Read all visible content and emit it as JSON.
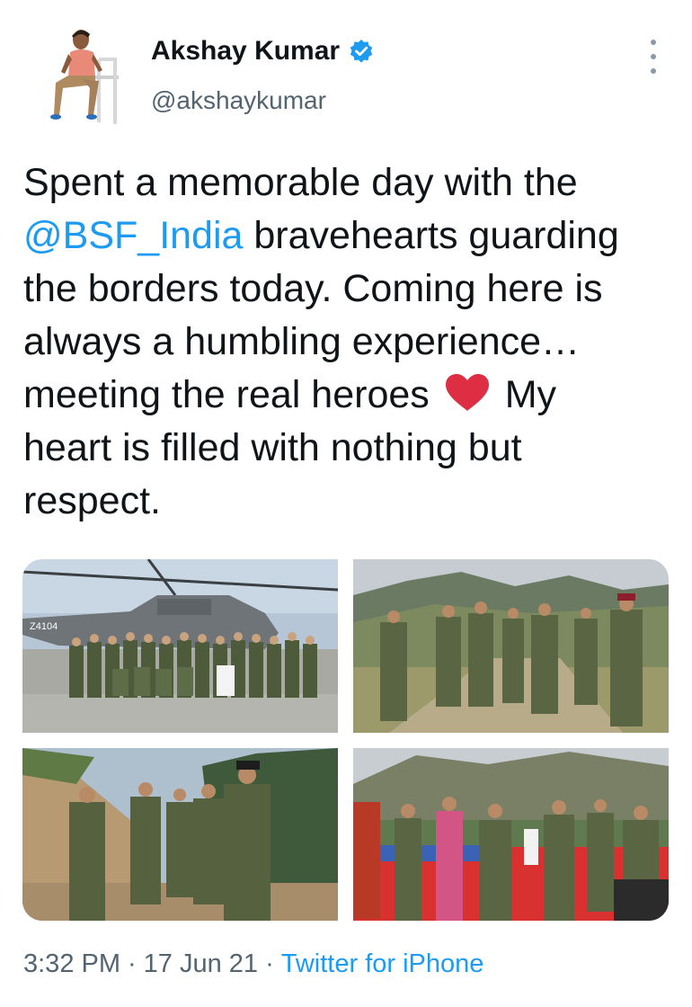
{
  "author": {
    "name": "Akshay Kumar",
    "handle": "@akshaykumar",
    "verified": true,
    "avatar_icon": "profile-photo"
  },
  "tweet": {
    "line1": "Spent a memorable day with the",
    "mention": "@BSF_India",
    "line2_rest": " bravehearts guarding",
    "line3": "the borders today. Coming here is",
    "line4": "always a humbling experience…",
    "line5_before_emoji": "meeting the real heroes",
    "emoji": "red-heart",
    "line5_after_emoji": "My",
    "line6": "heart is filled with nothing but",
    "line7": "respect."
  },
  "media": {
    "count": 4,
    "photos": [
      "helicopter-group-photo",
      "mountain-walk-photo",
      "hillside-walk-photo",
      "dance-celebration-photo"
    ],
    "helicopter_tail_number": "Z4104"
  },
  "meta": {
    "time": "3:32 PM",
    "separator": "·",
    "date": "17 Jun 21",
    "source": "Twitter for iPhone"
  },
  "colors": {
    "link": "#1d9bf0",
    "text": "#0f1419",
    "secondary": "#536471",
    "heart": "#e0245e"
  }
}
